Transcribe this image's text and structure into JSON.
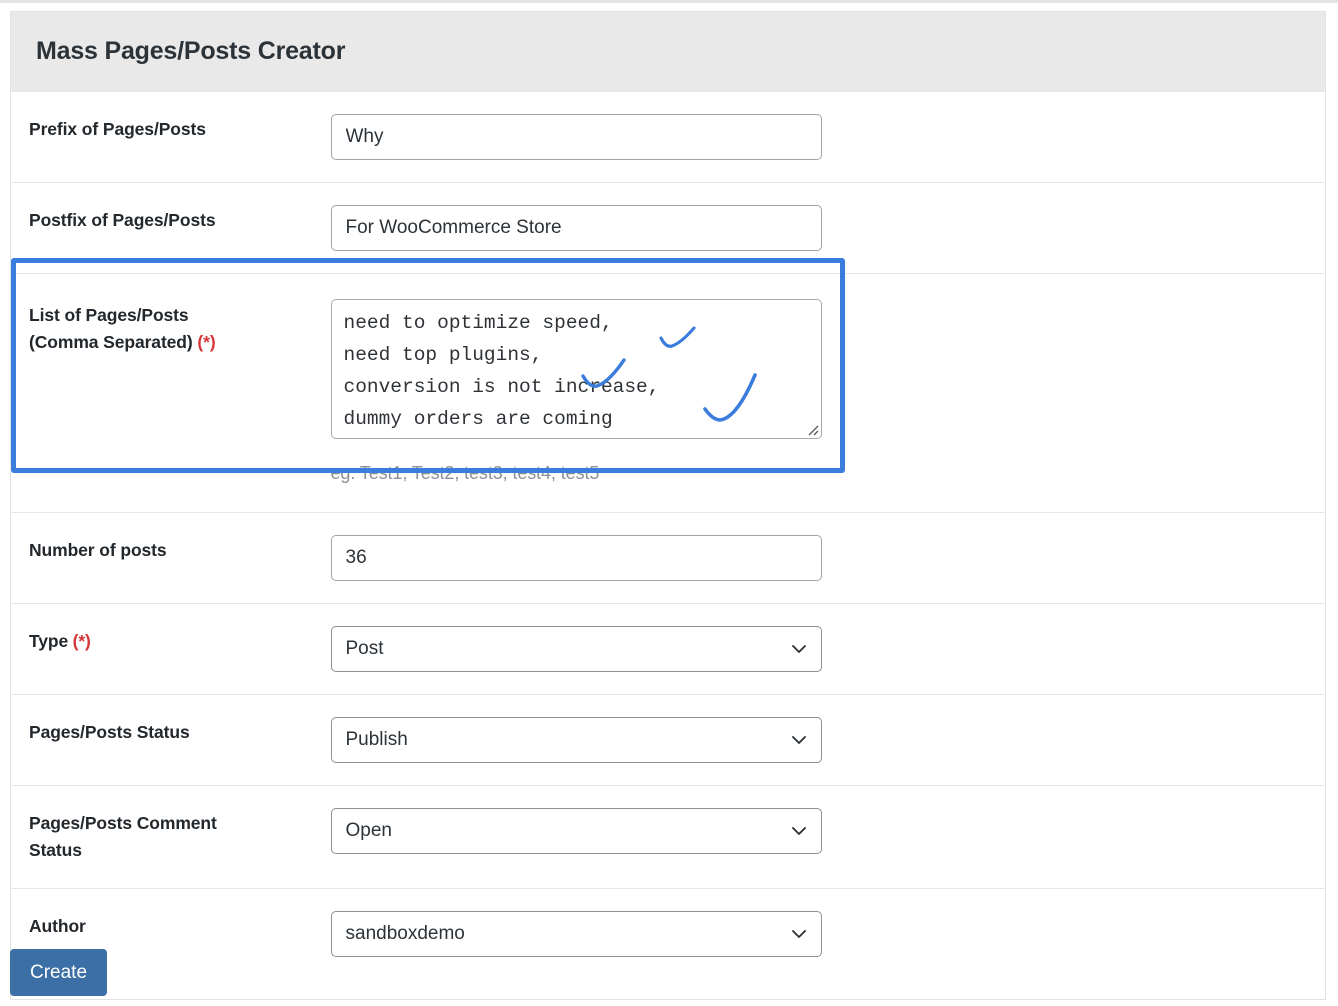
{
  "panel": {
    "title": "Mass Pages/Posts Creator"
  },
  "fields": {
    "prefix": {
      "label": "Prefix of Pages/Posts",
      "value": "Why"
    },
    "postfix": {
      "label": "Postfix of Pages/Posts",
      "value": "For WooCommerce Store"
    },
    "list": {
      "label_line1": "List of Pages/Posts",
      "label_line2": "(Comma Separated)",
      "required_marker": "(*)",
      "value": "need to optimize speed,\nneed top plugins,\nconversion is not increase,\ndummy orders are coming",
      "hint": "eg. Test1, Test2, test3, test4, test5"
    },
    "number_of_posts": {
      "label": "Number of posts",
      "value": "36"
    },
    "type": {
      "label": "Type",
      "required_marker": "(*)",
      "value": "Post"
    },
    "status": {
      "label": "Pages/Posts Status",
      "value": "Publish"
    },
    "comment_status": {
      "label_line1": "Pages/Posts Comment",
      "label_line2": "Status",
      "value": "Open"
    },
    "author": {
      "label": "Author",
      "value": "sandboxdemo"
    }
  },
  "actions": {
    "create_label": "Create"
  },
  "annotations": {
    "checkmarks": 3,
    "color": "#3b7ddd"
  },
  "colors": {
    "highlight": "#3b7ddd",
    "header_bg": "#e9e9e9",
    "required": "#d63638",
    "button": "#3c6fa5",
    "hint_text": "#8b9096"
  }
}
